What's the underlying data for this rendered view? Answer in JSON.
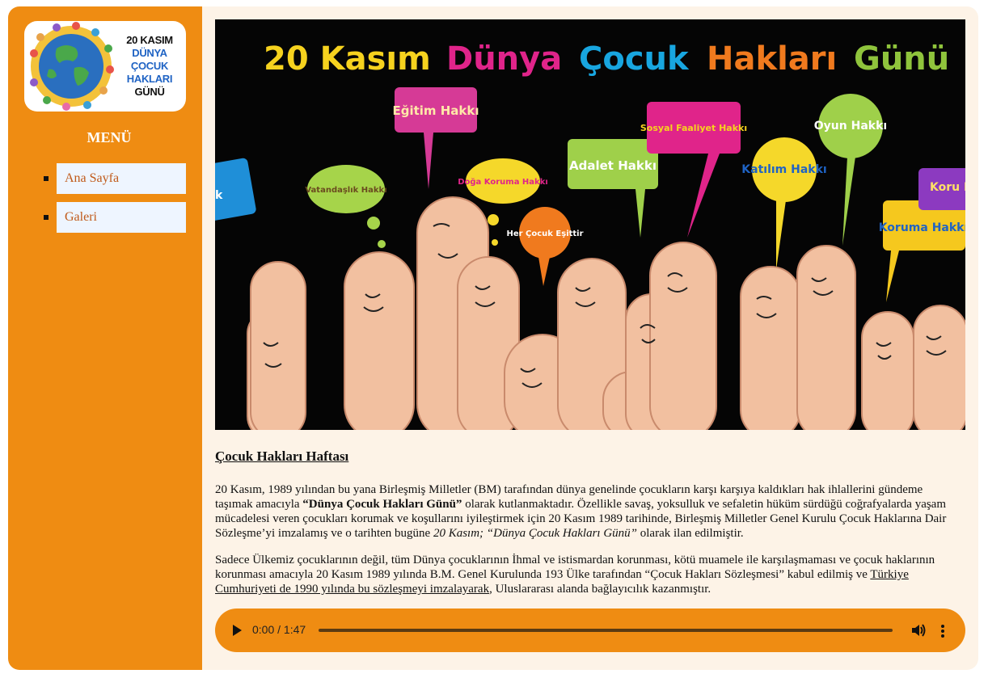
{
  "logo": {
    "line1": "20 KASIM",
    "line2": "DÜNYA",
    "line3": "ÇOCUK HAKLARI",
    "line4": "GÜNÜ"
  },
  "menu": {
    "title": "MENÜ",
    "items": [
      {
        "label": "Ana Sayfa"
      },
      {
        "label": "Galeri"
      }
    ]
  },
  "banner": {
    "headline_words": [
      "20 Kasım",
      "Dünya",
      "Çocuk",
      "Hakları",
      "Günü"
    ],
    "bubbles": [
      "Eğitim Hakkı",
      "Vatandaşlık Hakkı",
      "Doğa Koruma Hakkı",
      "Her Çocuk Eşittir",
      "Adalet Hakkı",
      "Sosyal Faaliyet Hakkı",
      "Katılım Hakkı",
      "Oyun Hakkı",
      "Koruma Hakkı",
      "Koru Hak",
      "k"
    ]
  },
  "article": {
    "title": "Çocuk Hakları Haftası",
    "p1_a": "20 Kasım, 1989 yılından bu yana Birleşmiş Milletler (BM) tarafından dünya genelinde çocukların karşı karşıya kaldıkları hak ihlallerini gündeme taşımak amacıyla ",
    "p1_bold": "“Dünya Çocuk Hakları Günü”",
    "p1_b": " olarak kutlanmaktadır. Özellikle savaş, yoksulluk ve sefaletin hüküm sürdüğü coğrafyalarda yaşam mücadelesi veren çocukları korumak ve koşullarını iyileştirmek için 20 Kasım 1989 tarihinde, Birleşmiş Milletler Genel Kurulu Çocuk Haklarına Dair Sözleşme’yi imzalamış ve o tarihten bugüne ",
    "p1_italic": "20 Kasım; “Dünya Çocuk Hakları Günü”",
    "p1_c": " olarak ilan edilmiştir.",
    "p2_a": "Sadece Ülkemiz çocuklarının değil, tüm Dünya çocuklarının İhmal ve istismardan korunması, kötü muamele ile karşılaşmaması ve çocuk haklarının korunması amacıyla 20 Kasım 1989 yılında B.M. Genel Kurulunda 193 Ülke tarafından “Çocuk Hakları Sözleşmesi” kabul edilmiş ve ",
    "p2_underline": "Türkiye Cumhuriyeti de 1990 yılında bu sözleşmeyi imzalayarak",
    "p2_b": ", Uluslararası alanda bağlayıcılık kazanmıştır."
  },
  "audio": {
    "time": "0:00 / 1:47",
    "progress": 0
  }
}
